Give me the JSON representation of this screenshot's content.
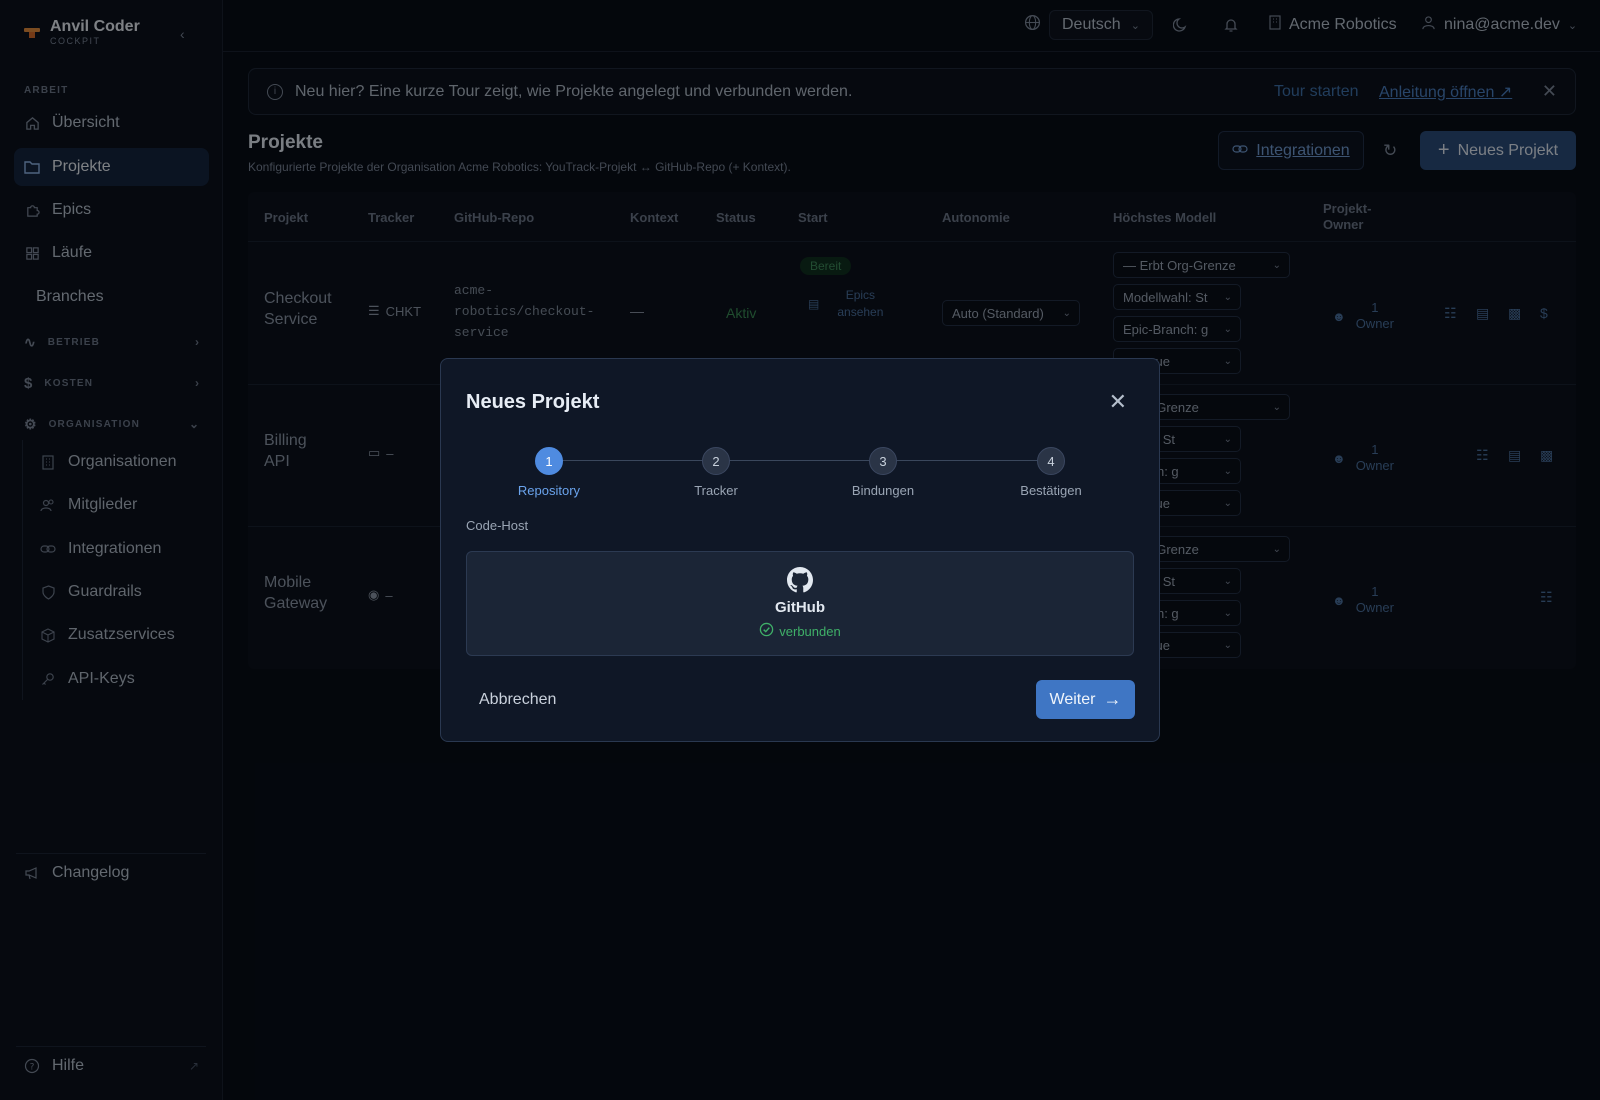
{
  "brand": {
    "name": "Anvil Coder",
    "sub": "COCKPIT"
  },
  "sidebar": {
    "section_arbeit": "ARBEIT",
    "items": [
      {
        "label": "Übersicht",
        "icon": "home-icon"
      },
      {
        "label": "Projekte",
        "icon": "folder-icon",
        "active": true
      },
      {
        "label": "Epics",
        "icon": "puzzle-icon"
      },
      {
        "label": "Läufe",
        "icon": "grid-icon"
      },
      {
        "label": "Branches",
        "icon": ""
      }
    ],
    "groups": [
      {
        "label": "BETRIEB",
        "icon": "activity-icon",
        "expanded": false
      },
      {
        "label": "KOSTEN",
        "icon": "dollar-icon",
        "expanded": false
      },
      {
        "label": "ORGANISATION",
        "icon": "gear-icon",
        "expanded": true
      }
    ],
    "org_items": [
      {
        "label": "Organisationen",
        "icon": "building-icon"
      },
      {
        "label": "Mitglieder",
        "icon": "users-icon"
      },
      {
        "label": "Integrationen",
        "icon": "link-icon"
      },
      {
        "label": "Guardrails",
        "icon": "shield-icon"
      },
      {
        "label": "Zusatzservices",
        "icon": "box-icon"
      },
      {
        "label": "API-Keys",
        "icon": "key-icon"
      }
    ],
    "changelog": "Changelog",
    "help": "Hilfe"
  },
  "topbar": {
    "language": "Deutsch",
    "org": "Acme Robotics",
    "user": "nina@acme.dev"
  },
  "banner": {
    "text": "Neu hier? Eine kurze Tour zeigt, wie Projekte angelegt und verbunden werden.",
    "tour": "Tour starten",
    "guide": "Anleitung öffnen"
  },
  "page": {
    "title": "Projekte",
    "subtitle": "Konfigurierte Projekte der Organisation Acme Robotics: YouTrack-Projekt ↔ GitHub-Repo (+ Kontext).",
    "integrations_button": "Integrationen",
    "new_button": "Neues Projekt"
  },
  "table": {
    "headers": {
      "projekt": "Projekt",
      "tracker": "Tracker",
      "repo": "GitHub-Repo",
      "kontext": "Kontext",
      "status": "Status",
      "start": "Start",
      "autonomie": "Autonomie",
      "modell": "Höchstes Modell",
      "owner_1": "Projekt-",
      "owner_2": "Owner"
    },
    "rows": [
      {
        "name_1": "Checkout",
        "name_2": "Service",
        "tracker": "CHKT",
        "repo_1": "acme-",
        "repo_2": "robotics/checkout-",
        "repo_3": "service",
        "kontext": "—",
        "status": "Aktiv",
        "start_badge": "Bereit",
        "start_link_1": "Epics",
        "start_link_2": "ansehen",
        "autonomie": "Auto (Standard)",
        "modell_1": "— Erbt Org-Grenze",
        "modell_2": "Modellwahl: St",
        "modell_3": "Epic-Branch: g",
        "modell_4": ": manue",
        "owner_count": "1",
        "owner_label": "Owner"
      },
      {
        "name_1": "Billing",
        "name_2": "API",
        "tracker": "–",
        "modell_1": "t Org-Grenze",
        "modell_2": "llwahl: St",
        "modell_3": "Branch: g",
        "modell_4": ": manue",
        "owner_count": "1",
        "owner_label": "Owner"
      },
      {
        "name_1": "Mobile",
        "name_2": "Gateway",
        "tracker": "–",
        "modell_1": "t Org-Grenze",
        "modell_2": "llwahl: St",
        "modell_3": "Branch: g",
        "modell_4": ": manue",
        "owner_count": "1",
        "owner_label": "Owner"
      }
    ]
  },
  "modal": {
    "title": "Neues Projekt",
    "steps": [
      {
        "num": "1",
        "label": "Repository",
        "active": true
      },
      {
        "num": "2",
        "label": "Tracker"
      },
      {
        "num": "3",
        "label": "Bindungen"
      },
      {
        "num": "4",
        "label": "Bestätigen"
      }
    ],
    "code_host_label": "Code-Host",
    "host": {
      "name": "GitHub",
      "status": "verbunden"
    },
    "cancel": "Abbrechen",
    "next": "Weiter"
  },
  "colors": {
    "accent": "#4f8be0",
    "success": "#3fb068",
    "background": "#080d17"
  }
}
